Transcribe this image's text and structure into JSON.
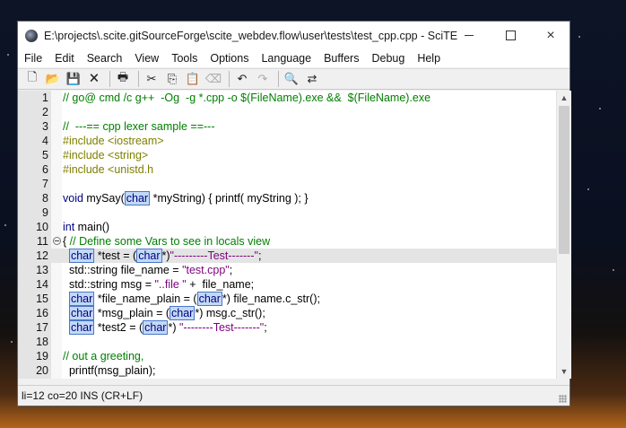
{
  "window": {
    "title": "E:\\projects\\.scite.gitSourceForge\\scite_webdev.flow\\user\\tests\\test_cpp.cpp - SciTE",
    "controls": {
      "minimize": "minimize-icon",
      "maximize": "maximize-icon",
      "close": "×"
    }
  },
  "menu": [
    "File",
    "Edit",
    "Search",
    "View",
    "Tools",
    "Options",
    "Language",
    "Buffers",
    "Debug",
    "Help"
  ],
  "toolbar": {
    "new": "🗋",
    "open": "📂",
    "save": "💾",
    "close": "🗙",
    "print": "🖶",
    "cut": "✂",
    "copy": "⎘",
    "paste": "📋",
    "delete": "⌫",
    "undo": "↶",
    "redo": "↷",
    "find": "🔍",
    "replace": "⇄"
  },
  "editor": {
    "lines": [
      {
        "n": "1",
        "html": "<span class=\"tok-com\">// go@ cmd /c g++  -Og  -g *.cpp -o $(FileName).exe &&  $(FileName).exe</span>"
      },
      {
        "n": "2",
        "html": ""
      },
      {
        "n": "3",
        "html": "<span class=\"tok-com\">//  ---== cpp lexer sample ==---</span>"
      },
      {
        "n": "4",
        "html": "<span class=\"tok-pre\">#include &lt;iostream&gt;</span>"
      },
      {
        "n": "5",
        "html": "<span class=\"tok-pre\">#include &lt;string&gt;</span>"
      },
      {
        "n": "6",
        "html": "<span class=\"tok-pre\">#include &lt;unistd.h</span>"
      },
      {
        "n": "7",
        "html": ""
      },
      {
        "n": "8",
        "html": "<span class=\"tok-kw\">void</span> mySay(<span class=\"hl\">char</span> *myString) { printf( myString ); }"
      },
      {
        "n": "9",
        "html": ""
      },
      {
        "n": "10",
        "html": "<span class=\"tok-kw\">int</span> main()"
      },
      {
        "n": "11",
        "html": "{ <span class=\"tok-com\">// Define some Vars to see in locals view</span>"
      },
      {
        "n": "12",
        "html": "  <span class=\"hl\">char</span> *test = (<span class=\"hl\">char</span>*)<span class=\"tok-str\">\"---------Test-------\"</span>;"
      },
      {
        "n": "13",
        "html": "  std::string file_name = <span class=\"tok-str\">\"test.cpp\"</span>;"
      },
      {
        "n": "14",
        "html": "  std::string msg = <span class=\"tok-str\">\"..file \"</span> +  file_name;"
      },
      {
        "n": "15",
        "html": "  <span class=\"hl\">char</span> *file_name_plain = (<span class=\"hl\">char</span>*) file_name.c_str();"
      },
      {
        "n": "16",
        "html": "  <span class=\"hl\">char</span> *msg_plain = (<span class=\"hl\">char</span>*) msg.c_str();"
      },
      {
        "n": "17",
        "html": "  <span class=\"hl\">char</span> *test2 = (<span class=\"hl\">char</span>*) <span class=\"tok-str\">\"--------Test-------\"</span>;"
      },
      {
        "n": "18",
        "html": ""
      },
      {
        "n": "19",
        "html": "<span class=\"tok-com\">// out a greeting,</span>"
      },
      {
        "n": "20",
        "html": "  printf(msg_plain);"
      }
    ],
    "caret_line": 12,
    "fold_line": 11
  },
  "status": {
    "text": "li=12 co=20 INS (CR+LF)"
  }
}
